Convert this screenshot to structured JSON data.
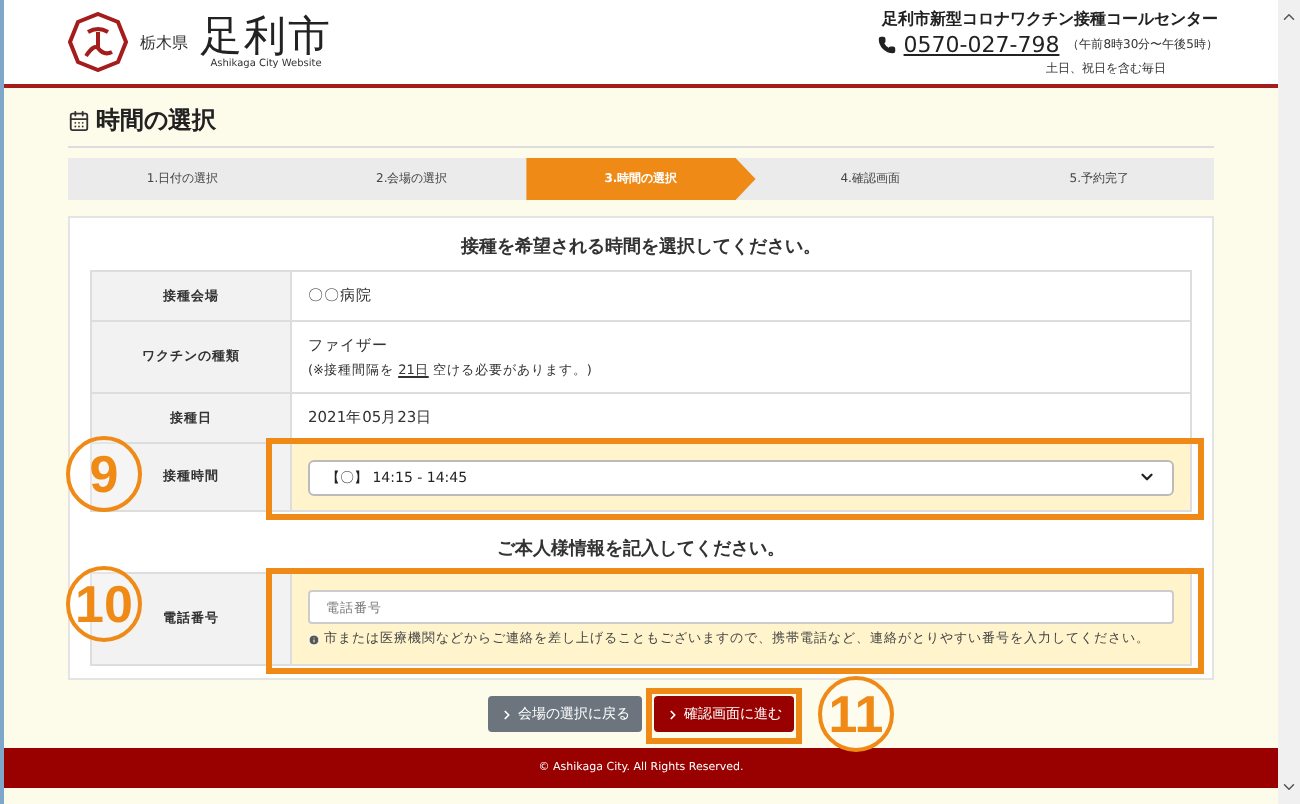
{
  "header": {
    "prefecture": "栃木県",
    "city": "足利市",
    "subtitle": "Ashikaga City Website",
    "center_name": "足利市新型コロナワクチン接種コールセンター",
    "phone": "0570-027-798",
    "hours": "（午前8時30分〜午後5時）",
    "days": "土日、祝日を含む毎日"
  },
  "page_title": "時間の選択",
  "steps": [
    {
      "label": "1.日付の選択",
      "selected": false
    },
    {
      "label": "2.会場の選択",
      "selected": false
    },
    {
      "label": "3.時間の選択",
      "selected": true
    },
    {
      "label": "4.確認画面",
      "selected": false
    },
    {
      "label": "5.予約完了",
      "selected": false
    }
  ],
  "time_section": {
    "heading": "接種を希望される時間を選択してください。",
    "rows": [
      {
        "kind": "text",
        "label": "接種会場",
        "value": "〇〇病院"
      },
      {
        "kind": "vaccine",
        "label": "ワクチンの種類",
        "value": "ファイザー",
        "note_prefix": "(※接種間隔を ",
        "note_highlight": "21日",
        "note_suffix": " 空ける必要があります。)"
      },
      {
        "kind": "text",
        "label": "接種日",
        "value": "2021年05月23日"
      },
      {
        "kind": "select",
        "label": "接種時間",
        "value": "【〇】 14:15 - 14:45",
        "callout": "9"
      }
    ]
  },
  "person_section": {
    "heading": "ご本人様情報を記入してください。",
    "rows": [
      {
        "kind": "input",
        "label": "電話番号",
        "placeholder": "電話番号",
        "help": "市または医療機関などからご連絡を差し上げることもございますので、携帯電話など、連絡がとりやすい番号を入力してください。",
        "callout": "10"
      }
    ]
  },
  "buttons": [
    {
      "kind": "back",
      "label": "会場の選択に戻る"
    },
    {
      "kind": "next",
      "label": "確認画面に進む",
      "callout": "11"
    }
  ],
  "footer": "© Ashikaga City. All Rights Reserved."
}
